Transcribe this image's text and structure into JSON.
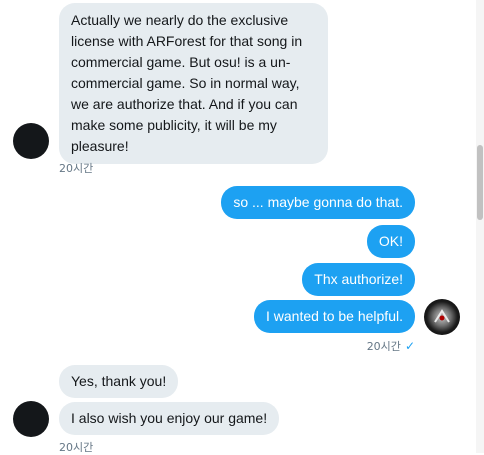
{
  "messages": [
    {
      "side": "received",
      "text": "Actually we nearly do the exclusive\nlicense with ARForest for that song in\ncommercial game. But osu! is a un-\ncommercial game. So in normal way,\nwe are authorize that. And if you can\nmake some publicity, it will be my\npleasure!",
      "timestamp": "20시간"
    },
    {
      "side": "sent",
      "texts": [
        "so ... maybe gonna do that.",
        "OK!",
        "Thx authorize!",
        "I wanted to be helpful."
      ],
      "timestamp": "20시간",
      "read_icon": "checkmark-icon"
    },
    {
      "side": "received",
      "texts": [
        "Yes, thank you!",
        "I also wish you enjoy our game!"
      ],
      "timestamp": "20시간"
    }
  ],
  "colors": {
    "sent_bubble": "#1da1f2",
    "received_bubble": "#e6ecf0",
    "timestamp": "#657786"
  },
  "icons": {
    "read_check": "✓"
  }
}
